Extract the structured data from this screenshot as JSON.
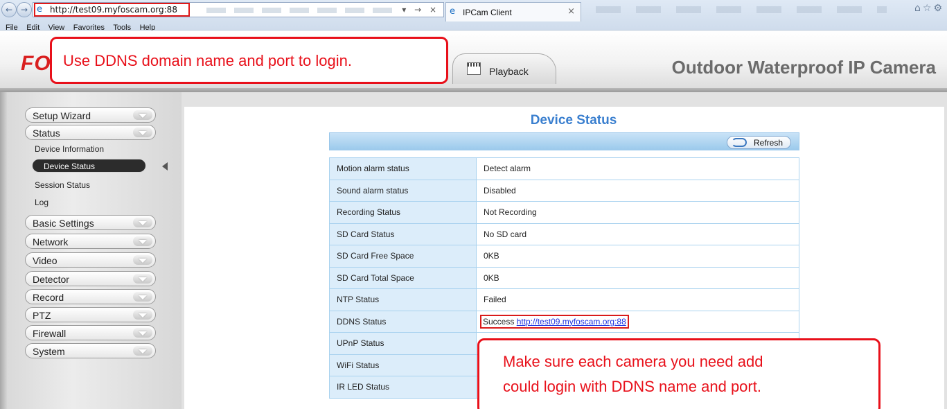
{
  "browser": {
    "url": "http://test09.myfoscam.org:88",
    "address_controls": "▾ → ×",
    "tab_title": "IPCam Client",
    "menu": [
      "File",
      "Edit",
      "View",
      "Favorites",
      "Tools",
      "Help"
    ]
  },
  "header": {
    "logo": "FO",
    "playback_tab": "Playback",
    "product_title": "Outdoor Waterproof IP Camera"
  },
  "callouts": {
    "top": "Use DDNS domain name and port to login.",
    "bottom_line1": "Make sure each camera you need add",
    "bottom_line2": "could login with DDNS name and port."
  },
  "sidebar": {
    "setup_wizard": "Setup Wizard",
    "status": "Status",
    "status_items": {
      "device_information": "Device Information",
      "device_status": "Device Status",
      "session_status": "Session Status",
      "log": "Log"
    },
    "basic_settings": "Basic Settings",
    "network": "Network",
    "video": "Video",
    "detector": "Detector",
    "record": "Record",
    "ptz": "PTZ",
    "firewall": "Firewall",
    "system": "System"
  },
  "main": {
    "title": "Device Status",
    "refresh": "Refresh",
    "rows": [
      {
        "label": "Motion alarm status",
        "value": "Detect alarm"
      },
      {
        "label": "Sound alarm status",
        "value": "Disabled"
      },
      {
        "label": "Recording Status",
        "value": "Not Recording"
      },
      {
        "label": "SD Card Status",
        "value": "No SD card"
      },
      {
        "label": "SD Card Free Space",
        "value": "0KB"
      },
      {
        "label": "SD Card Total Space",
        "value": "0KB"
      },
      {
        "label": "NTP Status",
        "value": "Failed"
      },
      {
        "label": "DDNS Status",
        "value_prefix": "Success",
        "link": "http://test09.myfoscam.org:88"
      },
      {
        "label": "UPnP Status",
        "value": ""
      },
      {
        "label": "WiFi Status",
        "value": ""
      },
      {
        "label": "IR LED Status",
        "value": ""
      }
    ]
  },
  "colors": {
    "callout_red": "#e8101a",
    "title_blue": "#3a7fcf",
    "logo_red": "#d91f1f"
  }
}
